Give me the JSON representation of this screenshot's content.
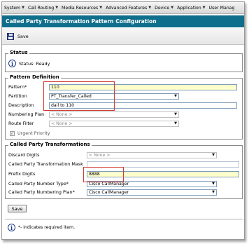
{
  "nav": {
    "items": [
      "System",
      "Call Routing",
      "Media Resources",
      "Advanced Features",
      "Device",
      "Application",
      "User Manag"
    ]
  },
  "title": "Called Party Transformation Pattern Configuration",
  "toolbar": {
    "save_label": "Save"
  },
  "status": {
    "heading": "Status",
    "text": "Status: Ready"
  },
  "pattern_definition": {
    "heading": "Pattern Definition",
    "pattern_label": "Pattern",
    "pattern_value": "110",
    "partition_label": "Partition",
    "partition_value": "PT_Transfer_Called",
    "description_label": "Description",
    "description_value": "dail to 110",
    "numbering_plan_label": "Numbering Plan",
    "numbering_plan_value": "< None >",
    "route_filter_label": "Route Filter",
    "route_filter_value": "< None >",
    "urgent_label": "Urgent Priority"
  },
  "transformations": {
    "heading": "Called Party Transformations",
    "discard_label": "Discard Digits",
    "discard_value": "< None >",
    "mask_label": "Called Party Transformation Mask",
    "mask_value": "",
    "prefix_label": "Prefix Digits",
    "prefix_value": "8888",
    "number_type_label": "Called Party Number Type",
    "number_type_value": "Cisco CallManager",
    "numbering_plan_label": "Called Party Numbering Plan",
    "numbering_plan_value": "Cisco CallManager"
  },
  "required_marker": "*",
  "footer": {
    "save_label": "Save",
    "note": "*- indicates required item."
  },
  "colors": {
    "title_bar": "#0f6e8c",
    "highlight": "#d23a2f",
    "required_input": "#ffffcc"
  }
}
